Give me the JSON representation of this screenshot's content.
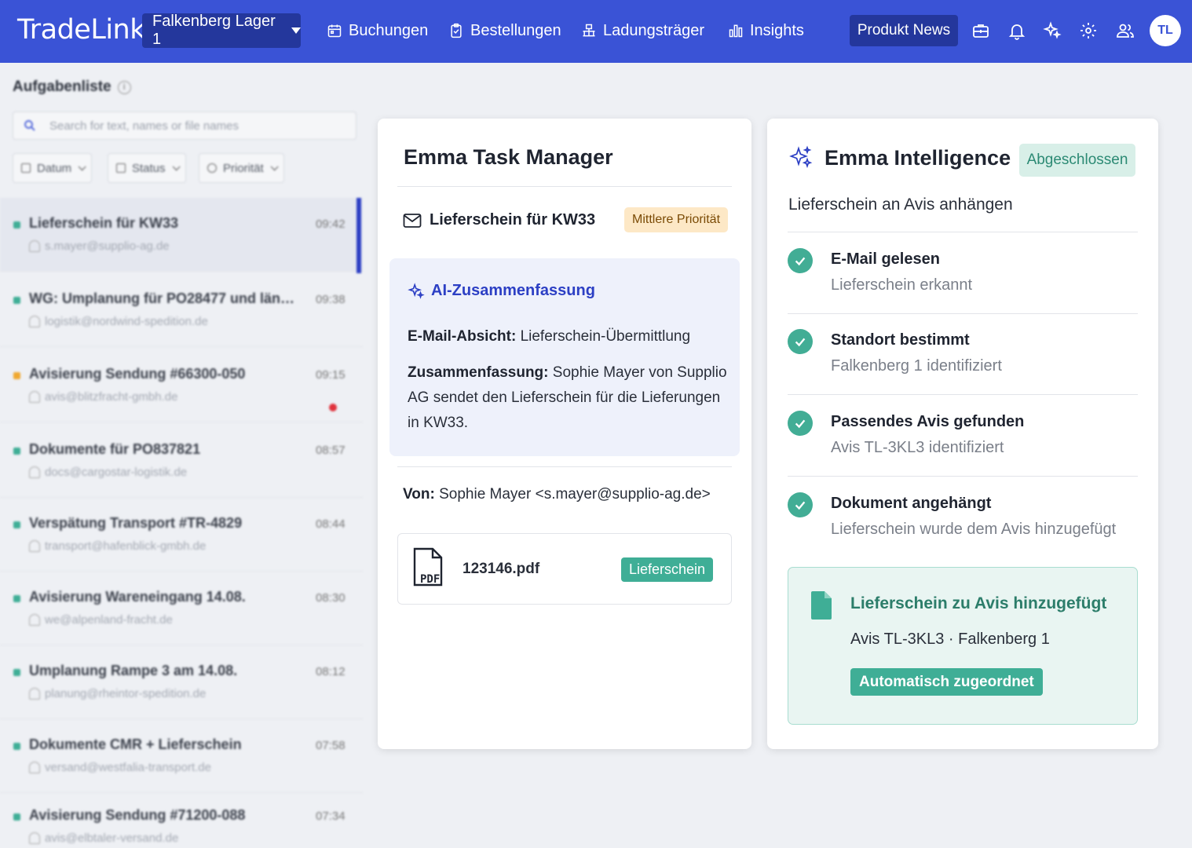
{
  "app": {
    "logo": "TradeLink",
    "location": "Falkenberg Lager 1",
    "nav": [
      {
        "label": "Buchungen",
        "icon": "calendar-icon"
      },
      {
        "label": "Bestellungen",
        "icon": "clipboard-check-icon"
      },
      {
        "label": "Ladungsträger",
        "icon": "pallet-icon"
      },
      {
        "label": "Insights",
        "icon": "bar-chart-icon"
      }
    ],
    "news_label": "Produkt News",
    "icons": [
      "briefcase-icon",
      "bell-icon",
      "sparkle-icon",
      "gear-icon",
      "users-icon"
    ],
    "avatar": "TL",
    "brand_color": "#3a53d6"
  },
  "task_list": {
    "title": "Aufgabenliste",
    "search_placeholder": "Search for text, names or file names",
    "filters": [
      "Datum",
      "Status",
      "Priorität"
    ],
    "items": [
      {
        "subject": "Lieferschein für KW33",
        "sender": "s.mayer@supplio-ag.de",
        "time": "09:42",
        "color": "#3fae96",
        "selected": true,
        "unread": false
      },
      {
        "subject": "WG: Umplanung für PO28477 und länger...",
        "sender": "logistik@nordwind-spedition.de",
        "time": "09:38",
        "color": "#3fae96",
        "selected": false,
        "unread": false
      },
      {
        "subject": "Avisierung Sendung #66300-050",
        "sender": "avis@blitzfracht-gmbh.de",
        "time": "09:15",
        "color": "#f0a830",
        "selected": false,
        "unread": true
      },
      {
        "subject": "Dokumente für PO837821",
        "sender": "docs@cargostar-logistik.de",
        "time": "08:57",
        "color": "#3fae96",
        "selected": false,
        "unread": false
      },
      {
        "subject": "Verspätung Transport #TR-4829",
        "sender": "transport@hafenblick-gmbh.de",
        "time": "08:44",
        "color": "#3fae96",
        "selected": false,
        "unread": false
      },
      {
        "subject": "Avisierung Wareneingang 14.08.",
        "sender": "we@alpenland-fracht.de",
        "time": "08:30",
        "color": "#3fae96",
        "selected": false,
        "unread": false
      },
      {
        "subject": "Umplanung Rampe 3 am 14.08.",
        "sender": "planung@rheintor-spedition.de",
        "time": "08:12",
        "color": "#3fae96",
        "selected": false,
        "unread": false
      },
      {
        "subject": "Dokumente CMR + Lieferschein",
        "sender": "versand@westfalia-transport.de",
        "time": "07:58",
        "color": "#3fae96",
        "selected": false,
        "unread": false
      },
      {
        "subject": "Avisierung Sendung #71200-088",
        "sender": "avis@elbtaler-versand.de",
        "time": "07:34",
        "color": "#3fae96",
        "selected": false,
        "unread": false
      }
    ]
  },
  "task_manager": {
    "title": "Emma Task Manager",
    "subject": "Lieferschein für KW33",
    "priority": "Mittlere Priorität",
    "ai_title": "AI-Zusammenfassung",
    "intent_label": "E-Mail-Absicht:",
    "intent_value": "Lieferschein-Übermittlung",
    "summary_label": "Zusammenfassung:",
    "summary_value": "Sophie Mayer von Supplio AG sendet den Lieferschein für die Lieferungen in KW33.",
    "from_label": "Von:",
    "from_value": "Sophie Mayer <s.mayer@supplio-ag.de>",
    "attachment_name": "123146.pdf",
    "attachment_tag": "Lieferschein",
    "pdf_label": "PDF"
  },
  "intelligence": {
    "title": "Emma Intelligence",
    "status": "Abgeschlossen",
    "task": "Lieferschein an Avis anhängen",
    "steps": [
      {
        "title": "E-Mail gelesen",
        "desc": "Lieferschein erkannt"
      },
      {
        "title": "Standort bestimmt",
        "desc": "Falkenberg 1 identifiziert"
      },
      {
        "title": "Passendes Avis gefunden",
        "desc": "Avis TL-3KL3 identifiziert"
      },
      {
        "title": "Dokument angehängt",
        "desc": "Lieferschein wurde dem Avis hinzugefügt"
      }
    ],
    "result_title": "Lieferschein zu Avis hinzugefügt",
    "result_sub": "Avis TL-3KL3 · Falkenberg 1",
    "result_button": "Automatisch zugeordnet",
    "accent_color": "#42ad95"
  }
}
